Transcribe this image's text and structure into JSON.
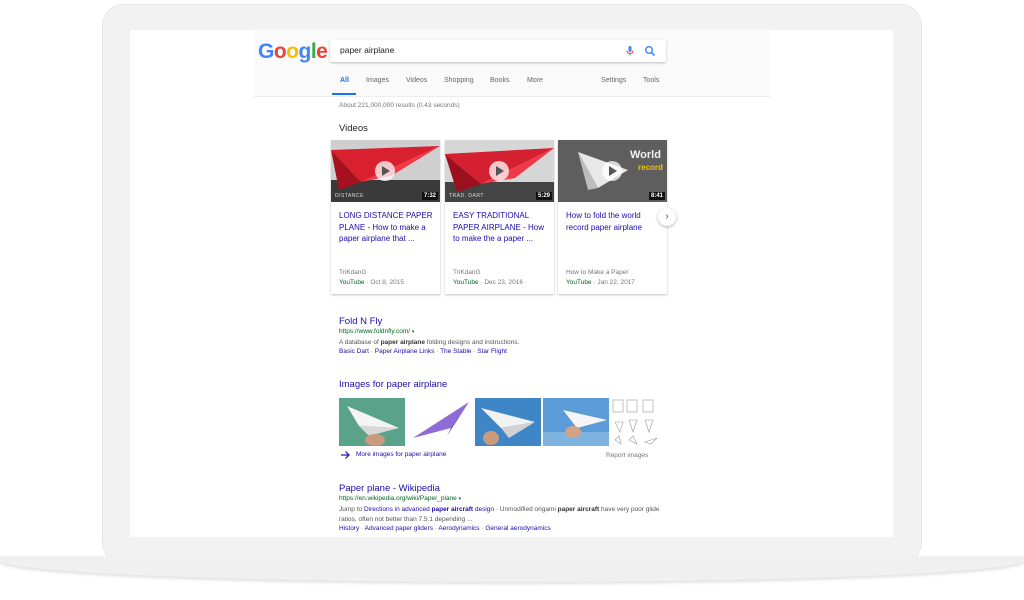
{
  "search": {
    "query": "paper airplane"
  },
  "logo": {
    "letters": [
      "G",
      "o",
      "o",
      "g",
      "l",
      "e"
    ],
    "colors": [
      "#4285f4",
      "#ea4335",
      "#fbbc05",
      "#4285f4",
      "#34a853",
      "#ea4335"
    ]
  },
  "tabs": [
    "All",
    "Images",
    "Videos",
    "Shopping",
    "Books",
    "More",
    "Settings",
    "Tools"
  ],
  "stats": "About 221,000,000 results (0.43 seconds)",
  "videos": {
    "heading": "Videos",
    "cards": [
      {
        "title": "LONG DISTANCE PAPER PLANE - How to make a paper airplane that ...",
        "duration": "7:32",
        "channel": "TriKdanG",
        "source": "YouTube",
        "date": " · Oct 8, 2015",
        "thumb_label": "DISTANCE"
      },
      {
        "title": "EASY TRADITIONAL PAPER AIRPLANE - How to make the a paper ...",
        "duration": "5:29",
        "channel": "TriKdanG",
        "source": "YouTube",
        "date": " · Dec 23, 2016",
        "thumb_label": "TRAD. DART"
      },
      {
        "title": "How to fold the world record paper airplane",
        "duration": "8:41",
        "channel": "How to Make a Paper",
        "source": "YouTube",
        "date": " · Jan 22, 2017",
        "thumb_word1": "World",
        "thumb_word2": "record"
      }
    ]
  },
  "result1": {
    "title": "Fold N Fly",
    "url": "https://www.foldnfly.com/",
    "snippet_pre": "A database of ",
    "snippet_bold": "paper airplane",
    "snippet_post": " folding designs and instructions.",
    "links": [
      "Basic Dart",
      "Paper Airplane Links",
      "The Stable",
      "Star Flight"
    ]
  },
  "images": {
    "heading": "Images for paper airplane",
    "more": "More images for paper airplane",
    "report": "Report images"
  },
  "result2": {
    "title": "Paper plane - Wikipedia",
    "url": "https://en.wikipedia.org/wiki/Paper_plane",
    "snippet_a": "Jump to ",
    "snippet_link": "Directions in advanced",
    "snippet_bold1": " paper aircraft",
    "snippet_link2": " design",
    "snippet_b": " · Unmodified origami ",
    "snippet_bold2": "paper aircraft",
    "snippet_c": " have very poor glide ratios, often not better than 7.5:1 depending ...",
    "links": [
      "History",
      "Advanced paper gliders",
      "Aerodynamics",
      "General aerodynamics"
    ]
  }
}
